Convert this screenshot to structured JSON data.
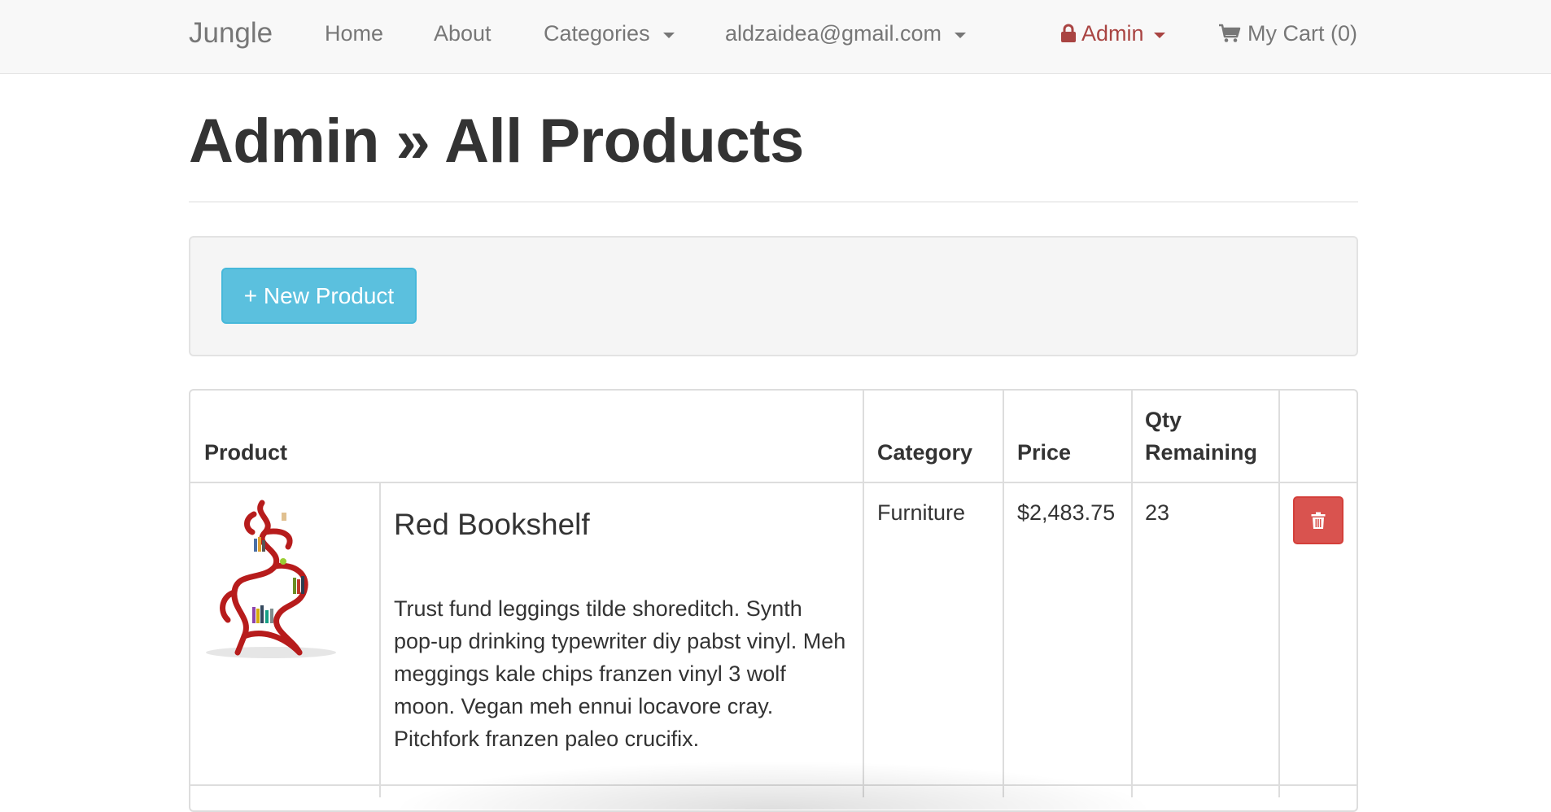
{
  "navbar": {
    "brand": "Jungle",
    "links": [
      "Home",
      "About"
    ],
    "categories_label": "Categories",
    "user_email": "aldzaidea@gmail.com",
    "admin_label": "Admin",
    "cart_label": "My Cart (0)",
    "admin_color": "#a94442"
  },
  "page": {
    "title": "Admin » All Products"
  },
  "actions": {
    "new_product_label": "+ New Product",
    "button_color": "#5bc0de"
  },
  "table": {
    "headers": {
      "product": "Product",
      "category": "Category",
      "price": "Price",
      "qty_line1": "Qty",
      "qty_line2": "Remaining"
    },
    "rows": [
      {
        "image_icon": "red-bookshelf-image",
        "name": "Red Bookshelf",
        "description": "Trust fund leggings tilde shoreditch. Synth pop-up drinking typewriter diy pabst vinyl. Meh meggings kale chips franzen vinyl 3 wolf moon. Vegan meh ennui locavore cray. Pitchfork franzen paleo crucifix.",
        "category": "Furniture",
        "price": "$2,483.75",
        "qty": "23",
        "delete_icon": "trash-icon",
        "delete_color": "#d9534f"
      }
    ]
  }
}
